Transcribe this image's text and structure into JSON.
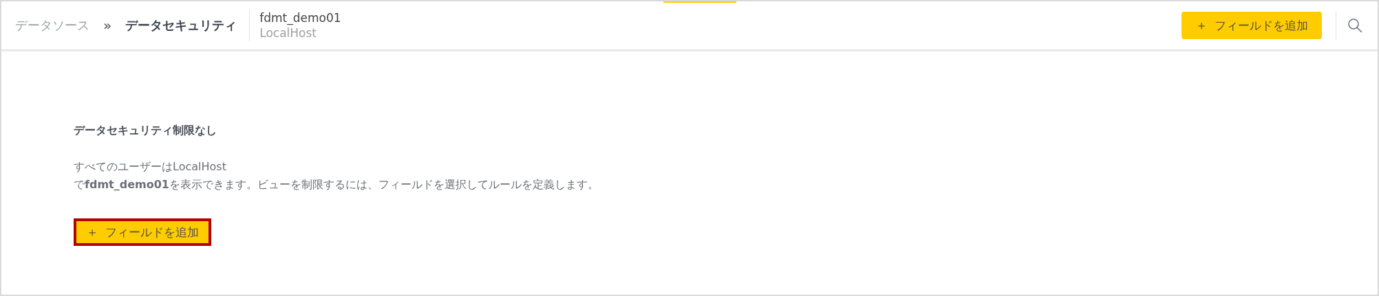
{
  "header": {
    "breadcrumb": [
      {
        "label": "データソース",
        "current": false
      },
      {
        "label": "データセキュリティ",
        "current": true
      }
    ],
    "separator": "»",
    "datasource": {
      "name": "fdmt_demo01",
      "host": "LocalHost"
    },
    "add_button": {
      "icon": "＋",
      "label": "フィールドを追加"
    }
  },
  "content": {
    "title": "データセキュリティ制限なし",
    "message": "すべてのユーザーはLocalHost\nで**fdmt_demo01**を表示できます。ビューを制限するには、フィールドを選択してルールを定義します。",
    "add_button": {
      "icon": "＋",
      "label": "フィールドを追加",
      "highlighted": true
    }
  }
}
